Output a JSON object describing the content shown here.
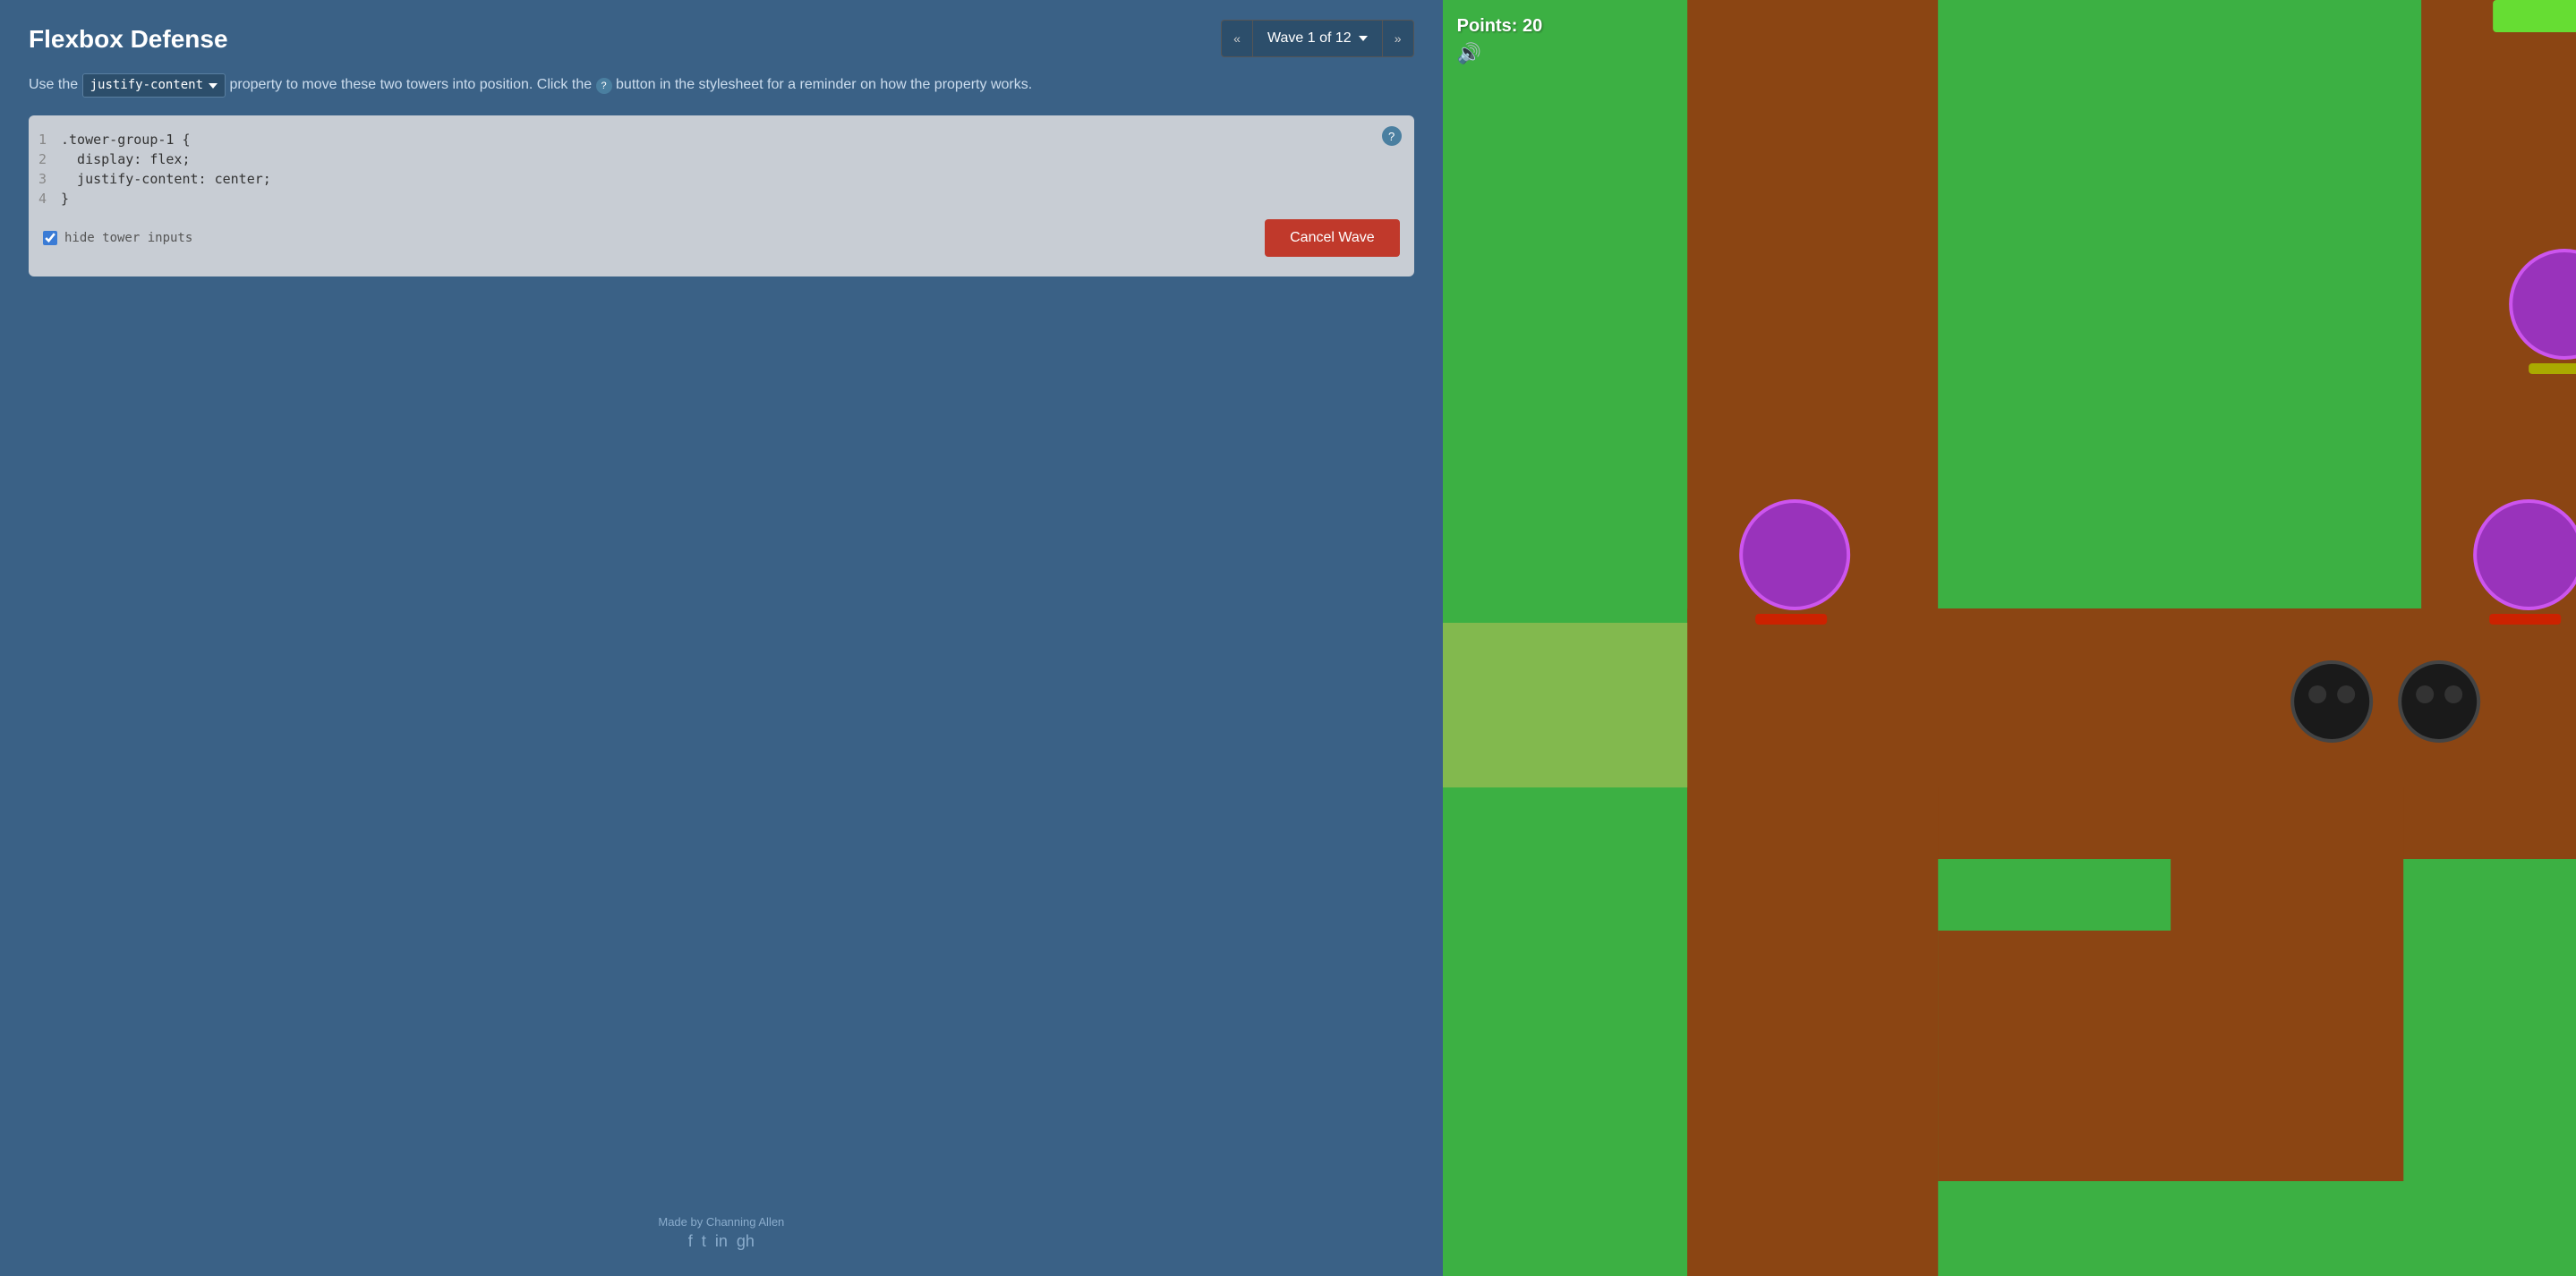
{
  "app": {
    "title": "Flexbox Defense"
  },
  "wave_nav": {
    "prev_label": "«",
    "next_label": "»",
    "current_wave": "Wave 1 of 12",
    "chevron": "▾"
  },
  "instruction": {
    "prefix": "Use the",
    "property": "justify-content",
    "suffix": "property to move these two towers into position. Click the",
    "suffix2": "button in the stylesheet for a reminder on how the property works."
  },
  "code": {
    "help_label": "?",
    "lines": [
      {
        "num": "1",
        "text": ".tower-group-1 {"
      },
      {
        "num": "2",
        "text": "    display: flex;"
      },
      {
        "num": "3",
        "text": "    justify-content: center;"
      },
      {
        "num": "4",
        "text": "}"
      }
    ]
  },
  "editor_footer": {
    "checkbox_label": "hide tower inputs",
    "checkbox_checked": true,
    "cancel_btn": "Cancel Wave"
  },
  "attribution": {
    "text": "Made by Channing Allen",
    "social": [
      "f",
      "t",
      "in",
      "gh"
    ]
  },
  "game": {
    "points_label": "Points: 20",
    "sound_icon": "🔊"
  },
  "colors": {
    "left_bg": "#3a6186",
    "right_bg": "#3cb043",
    "path_brown": "#8B4513",
    "path_light_green": "#90c843",
    "tower_purple": "#9933cc",
    "enemy_dark": "#222222",
    "cancel_red": "#c0392b"
  }
}
